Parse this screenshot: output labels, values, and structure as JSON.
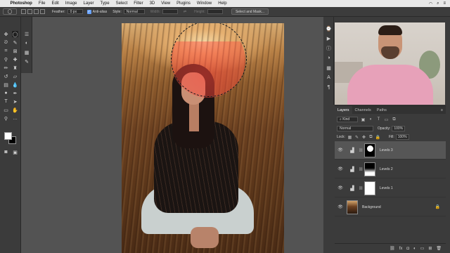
{
  "menubar": {
    "apple": "",
    "app": "Photoshop",
    "items": [
      "File",
      "Edit",
      "Image",
      "Layer",
      "Type",
      "Select",
      "Filter",
      "3D",
      "View",
      "Plugins",
      "Window",
      "Help"
    ]
  },
  "options": {
    "feather_label": "Feather:",
    "feather_value": "0 px",
    "antialias_label": "Anti-alias",
    "style_label": "Style:",
    "style_value": "Normal",
    "width_label": "Width:",
    "height_label": "Height:",
    "select_mask": "Select and Mask..."
  },
  "lefttools": {
    "icons": [
      "move-icon",
      "marquee-icon",
      "lasso-icon",
      "quick-select-icon",
      "crop-icon",
      "frame-icon",
      "eyedropper-icon",
      "spot-heal-icon",
      "brush-icon",
      "stamp-icon",
      "history-brush-icon",
      "eraser-icon",
      "gradient-icon",
      "blur-icon",
      "dodge-icon",
      "pen-icon",
      "type-icon",
      "path-select-icon",
      "rectangle-icon",
      "hand-icon",
      "zoom-icon",
      "more-icon"
    ]
  },
  "layers_panel": {
    "tabs": [
      "Layers",
      "Channels",
      "Paths"
    ],
    "kind": "Kind",
    "blend_mode": "Normal",
    "opacity_label": "Opacity:",
    "opacity_value": "100%",
    "lock_label": "Lock:",
    "fill_label": "Fill:",
    "fill_value": "100%",
    "layers": [
      {
        "name": "Levels 3"
      },
      {
        "name": "Levels 2"
      },
      {
        "name": "Levels 1"
      },
      {
        "name": "Background"
      }
    ]
  }
}
